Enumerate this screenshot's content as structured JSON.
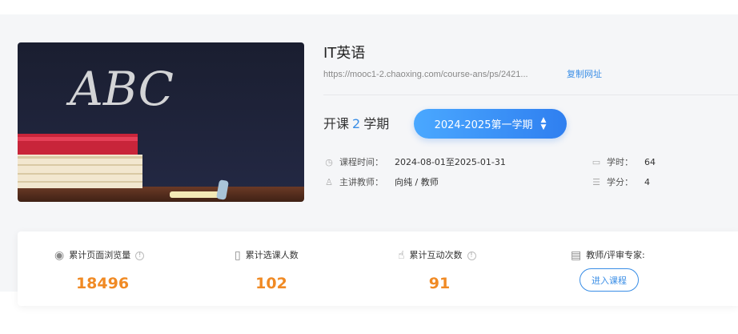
{
  "course": {
    "title": "IT英语",
    "url": "https://mooc1-2.chaoxing.com/course-ans/ps/2421...",
    "copy_label": "复制网址",
    "sessions_prefix": "开课",
    "sessions_count": "2",
    "sessions_suffix": "学期",
    "term": "2024-2025第一学期",
    "cover_text": "ABC"
  },
  "meta": {
    "time_label": "课程时间：",
    "time_value": "2024-08-01至2025-01-31",
    "teacher_label": "主讲教师：",
    "teacher_value": "向纯 / 教师",
    "hours_label": "学时：",
    "hours_value": "64",
    "credits_label": "学分：",
    "credits_value": "4"
  },
  "stats": {
    "views_label": "累计页面浏览量",
    "views_value": "18496",
    "enroll_label": "累计选课人数",
    "enroll_value": "102",
    "interact_label": "累计互动次数",
    "interact_value": "91",
    "reviewer_label": "教师/评审专家:",
    "enter_label": "进入课程"
  },
  "icons": {
    "clock": "clock-icon",
    "teacher": "person-icon",
    "calendar": "calendar-icon",
    "credits": "stack-icon",
    "views": "eye-icon",
    "enroll": "book-icon",
    "interact": "hand-pointer-icon",
    "reviewer": "document-user-icon",
    "info": "info-icon"
  },
  "colors": {
    "accent": "#3a8ee6",
    "stat_value": "#f08a24",
    "panel_bg": "#f5f6f8"
  }
}
